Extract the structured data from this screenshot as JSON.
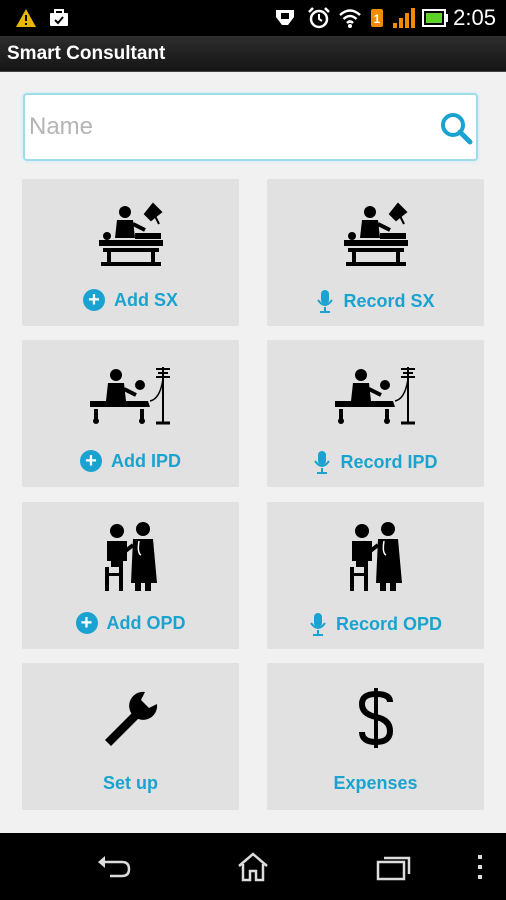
{
  "status_bar": {
    "time": "2:05",
    "icons": [
      "warning-icon",
      "briefcase-icon",
      "usb-icon",
      "alarm-clock-icon",
      "wifi-icon",
      "data-icon",
      "signal-icon",
      "battery-icon"
    ]
  },
  "app": {
    "title": "Smart Consultant"
  },
  "search": {
    "placeholder": "Name",
    "value": ""
  },
  "tiles": [
    {
      "label": "Add SX",
      "icon": "surgery-icon",
      "action_icon": "plus-icon"
    },
    {
      "label": "Record SX",
      "icon": "surgery-icon",
      "action_icon": "mic-icon"
    },
    {
      "label": "Add IPD",
      "icon": "inpatient-bed-icon",
      "action_icon": "plus-icon"
    },
    {
      "label": "Record IPD",
      "icon": "inpatient-bed-icon",
      "action_icon": "mic-icon"
    },
    {
      "label": "Add OPD",
      "icon": "doctor-patient-icon",
      "action_icon": "plus-icon"
    },
    {
      "label": "Record OPD",
      "icon": "doctor-patient-icon",
      "action_icon": "mic-icon"
    },
    {
      "label": "Set up",
      "icon": "wrench-icon",
      "action_icon": ""
    },
    {
      "label": "Expenses",
      "icon": "dollar-icon",
      "action_icon": ""
    }
  ],
  "nav_bar": {
    "buttons": [
      "back-icon",
      "home-icon",
      "recent-apps-icon",
      "overflow-menu-icon"
    ]
  },
  "colors": {
    "accent": "#1aa3d0",
    "tile_bg": "#e1e1e1",
    "search_border": "#9edcec"
  }
}
